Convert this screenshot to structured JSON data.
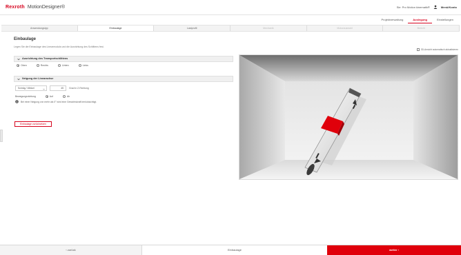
{
  "header": {
    "brand": "Rexroth",
    "app_name": "MotionDesigner",
    "app_mark": "®",
    "project_link": "Sie: Pro Motion kinematik®",
    "user_icon": "user-icon",
    "user_name": "Menü/Konto"
  },
  "nav": {
    "items": [
      {
        "label": "Projektverwaltung",
        "active": false
      },
      {
        "label": "Auslegung",
        "active": true
      },
      {
        "label": "Einstellungen",
        "active": false
      }
    ]
  },
  "steps": [
    {
      "label": "Anwendungstyp",
      "state": "done"
    },
    {
      "label": "Einbaulage",
      "state": "active"
    },
    {
      "label": "Lastprofil",
      "state": "done"
    },
    {
      "label": "Mechanik",
      "state": "disabled"
    },
    {
      "label": "Motorauswahl",
      "state": "disabled"
    },
    {
      "label": "Bericht",
      "state": "disabled"
    }
  ],
  "main": {
    "title": "Einbaulage",
    "intro": "Legen Sie die Einbaulage des Linearmoduls und die Ausrichtung des Schlittens fest.",
    "preview_toggle_label": "3D-Ansicht automatisch aktualisieren",
    "section_orientation": {
      "title": "Ausrichtung des Transportschlittens",
      "options": [
        "Oben",
        "Rechts",
        "Unten",
        "Links"
      ],
      "selected": "Oben"
    },
    "section_angle": {
      "title": "Neigung der Linearachse",
      "mode_value": "Schräg / Winkel",
      "angle_value": "45",
      "angle_unit": "Grad in Z-Richtung",
      "direction_label": "Bewegungsrichtung",
      "direction_options": [
        "Auf",
        "Ab"
      ],
      "direction_selected": "Auf",
      "info_note": "Bei einer Neigung von mehr als 0° wird eine Gewichtskraft berücksichtigt."
    },
    "reset_button": "Einbaulage zurücksetzen"
  },
  "footer": {
    "back_label": "‹  zurück",
    "current_label": "Einbaulage",
    "next_label": "weiter  ›"
  },
  "colors": {
    "brand_red": "#d6001c",
    "next_button": "#e0000b",
    "carriage": "#e0000b"
  }
}
